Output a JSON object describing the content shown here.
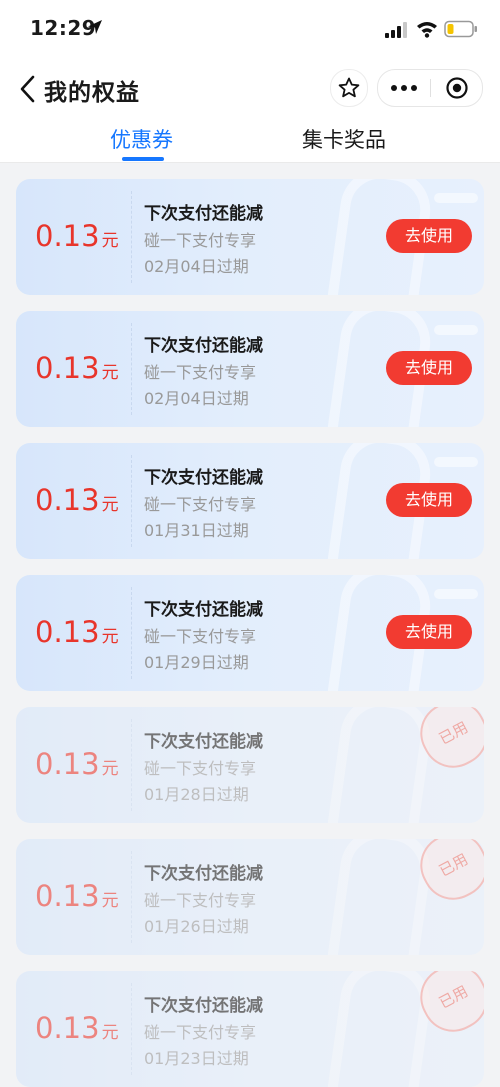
{
  "status_bar": {
    "time": "12:29"
  },
  "header": {
    "title": "我的权益"
  },
  "tabs": [
    {
      "label": "优惠券",
      "active": true
    },
    {
      "label": "集卡奖品",
      "active": false
    }
  ],
  "accent_color": "#1677ff",
  "coupons": [
    {
      "amount": "0.13",
      "unit": "元",
      "title": "下次支付还能减",
      "subtitle": "碰一下支付专享",
      "expiry": "02月04日过期",
      "action": "去使用",
      "used": false
    },
    {
      "amount": "0.13",
      "unit": "元",
      "title": "下次支付还能减",
      "subtitle": "碰一下支付专享",
      "expiry": "02月04日过期",
      "action": "去使用",
      "used": false
    },
    {
      "amount": "0.13",
      "unit": "元",
      "title": "下次支付还能减",
      "subtitle": "碰一下支付专享",
      "expiry": "01月31日过期",
      "action": "去使用",
      "used": false
    },
    {
      "amount": "0.13",
      "unit": "元",
      "title": "下次支付还能减",
      "subtitle": "碰一下支付专享",
      "expiry": "01月29日过期",
      "action": "去使用",
      "used": false
    },
    {
      "amount": "0.13",
      "unit": "元",
      "title": "下次支付还能减",
      "subtitle": "碰一下支付专享",
      "expiry": "01月28日过期",
      "stamp": "已用",
      "used": true
    },
    {
      "amount": "0.13",
      "unit": "元",
      "title": "下次支付还能减",
      "subtitle": "碰一下支付专享",
      "expiry": "01月26日过期",
      "stamp": "已用",
      "used": true
    },
    {
      "amount": "0.13",
      "unit": "元",
      "title": "下次支付还能减",
      "subtitle": "碰一下支付专享",
      "expiry": "01月23日过期",
      "stamp": "已用",
      "used": true
    }
  ]
}
